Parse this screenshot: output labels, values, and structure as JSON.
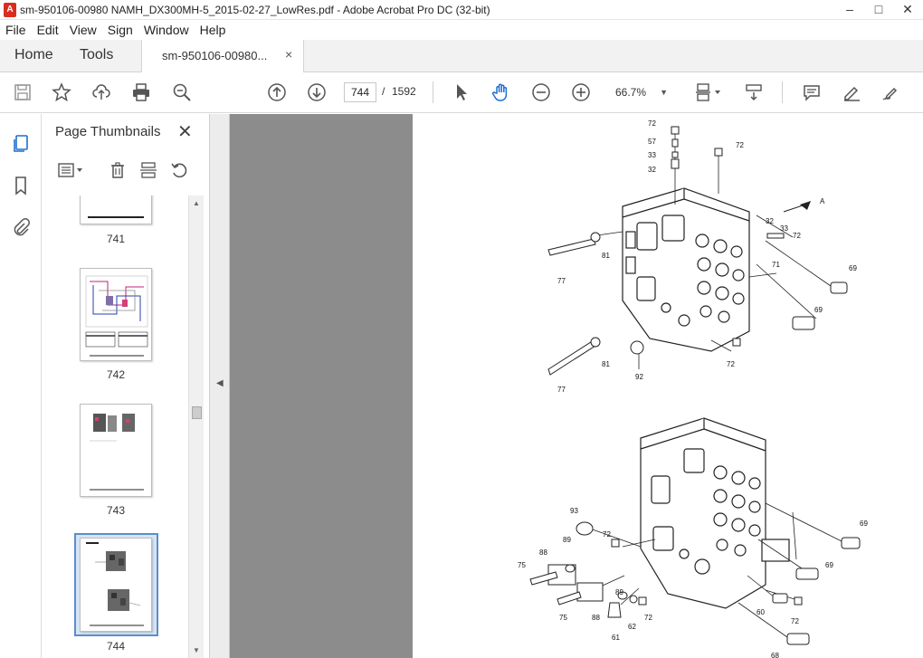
{
  "window": {
    "title": "sm-950106-00980 NAMH_DX300MH-5_2015-02-27_LowRes.pdf - Adobe Acrobat Pro DC (32-bit)",
    "controls": [
      "–",
      "□",
      "✕"
    ]
  },
  "menu": [
    "File",
    "Edit",
    "View",
    "Sign",
    "Window",
    "Help"
  ],
  "tabs": {
    "home": "Home",
    "tools": "Tools",
    "document": "sm-950106-00980...",
    "close": "×"
  },
  "toolbar": {
    "icons": [
      "save-icon",
      "bookmark-star-icon",
      "share-upload-icon",
      "print-icon",
      "zoom-search-icon",
      "previous-page-icon",
      "next-page-icon",
      "select-pointer-icon",
      "hand-pan-icon",
      "zoom-out-icon",
      "zoom-in-icon",
      "page-view-icon",
      "scroll-mode-icon",
      "comment-icon",
      "highlight-pen-icon",
      "sign-pen-icon"
    ],
    "current_page": "744",
    "page_separator": "/",
    "total_pages": "1592",
    "zoom": "66.7%"
  },
  "side_panel": {
    "title": "Page Thumbnails",
    "close": "✕",
    "thumbnails": [
      {
        "page": "741"
      },
      {
        "page": "742"
      },
      {
        "page": "743"
      },
      {
        "page": "744",
        "selected": true
      }
    ]
  },
  "diagram": {
    "callouts_top": [
      "72",
      "57",
      "33",
      "32",
      "72",
      "32",
      "33",
      "72",
      "A",
      "69",
      "71",
      "81",
      "77",
      "69",
      "81",
      "72",
      "92",
      "77"
    ],
    "callouts_bottom": [
      "93",
      "72",
      "69",
      "88",
      "89",
      "69",
      "75",
      "89",
      "72",
      "88",
      "75",
      "62",
      "61",
      "60",
      "72",
      "68"
    ]
  }
}
